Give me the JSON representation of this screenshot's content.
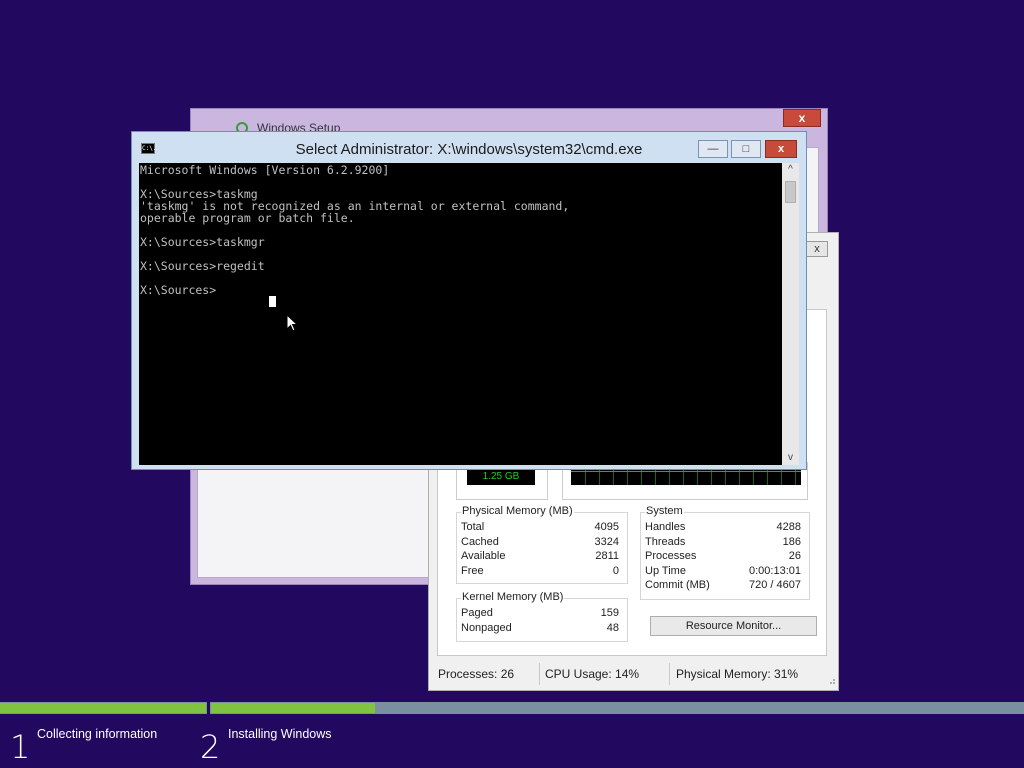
{
  "setup_window": {
    "title": "Windows Setup",
    "close_label": "x"
  },
  "task_manager": {
    "close_label": "x",
    "memory_readout": "1.25 GB",
    "physical_memory": {
      "title": "Physical Memory (MB)",
      "rows": [
        {
          "label": "Total",
          "value": "4095"
        },
        {
          "label": "Cached",
          "value": "3324"
        },
        {
          "label": "Available",
          "value": "2811"
        },
        {
          "label": "Free",
          "value": "0"
        }
      ]
    },
    "kernel_memory": {
      "title": "Kernel Memory (MB)",
      "rows": [
        {
          "label": "Paged",
          "value": "159"
        },
        {
          "label": "Nonpaged",
          "value": "48"
        }
      ]
    },
    "system": {
      "title": "System",
      "rows": [
        {
          "label": "Handles",
          "value": "4288"
        },
        {
          "label": "Threads",
          "value": "186"
        },
        {
          "label": "Processes",
          "value": "26"
        },
        {
          "label": "Up Time",
          "value": "0:00:13:01"
        },
        {
          "label": "Commit (MB)",
          "value": "720 / 4607"
        }
      ]
    },
    "resource_monitor_button": "Resource Monitor...",
    "status": {
      "processes": "Processes: 26",
      "cpu": "CPU Usage: 14%",
      "memory": "Physical Memory: 31%"
    }
  },
  "cmd_window": {
    "icon_text": "C:\\.",
    "title": "Select Administrator: X:\\windows\\system32\\cmd.exe",
    "minimize_label": "—",
    "maximize_label": "□",
    "close_label": "x",
    "console_text": "Microsoft Windows [Version 6.2.9200]\n\nX:\\Sources>taskmg\n'taskmg' is not recognized as an internal or external command,\noperable program or batch file.\n\nX:\\Sources>taskmgr\n\nX:\\Sources>regedit\n\nX:\\Sources>",
    "scroll_up": "^",
    "scroll_down": "v"
  },
  "setup_progress": {
    "steps": [
      {
        "number": "1",
        "label": "Collecting information"
      },
      {
        "number": "2",
        "label": "Installing Windows"
      }
    ],
    "colors": {
      "done": "#80c340",
      "remaining": "#7a8fa0",
      "background": "#22085e"
    }
  }
}
